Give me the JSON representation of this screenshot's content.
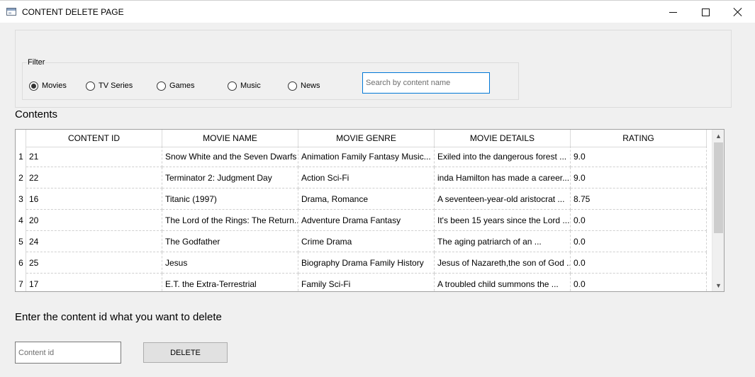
{
  "window": {
    "title": "CONTENT DELETE PAGE"
  },
  "filter": {
    "label": "Filter",
    "options": [
      {
        "label": "Movies",
        "checked": true
      },
      {
        "label": "TV Series",
        "checked": false
      },
      {
        "label": "Games",
        "checked": false
      },
      {
        "label": "Music",
        "checked": false
      },
      {
        "label": "News",
        "checked": false
      }
    ],
    "search_placeholder": "Search by content name"
  },
  "contents": {
    "label": "Contents",
    "columns": [
      "CONTENT ID",
      "MOVIE NAME",
      "MOVIE GENRE",
      "MOVIE DETAILS",
      "RATING"
    ],
    "rows": [
      {
        "num": "1",
        "id": "21",
        "name": "Snow White and the Seven Dwarfs",
        "genre": "Animation Family Fantasy Music...",
        "details": "Exiled into the dangerous forest ...",
        "rating": "9.0"
      },
      {
        "num": "2",
        "id": "22",
        "name": "Terminator 2: Judgment Day",
        "genre": "Action Sci-Fi",
        "details": "inda Hamilton has made a career...",
        "rating": "9.0"
      },
      {
        "num": "3",
        "id": "16",
        "name": "Titanic (1997)",
        "genre": "Drama, Romance",
        "details": "A seventeen-year-old aristocrat ...",
        "rating": "8.75"
      },
      {
        "num": "4",
        "id": "20",
        "name": "The Lord of the Rings: The Return...",
        "genre": "Adventure Drama Fantasy",
        "details": "It's been 15 years since the Lord ...",
        "rating": "0.0"
      },
      {
        "num": "5",
        "id": "24",
        "name": "The Godfather",
        "genre": "Crime Drama",
        "details": "The aging patriarch of an ...",
        "rating": "0.0"
      },
      {
        "num": "6",
        "id": "25",
        "name": "Jesus",
        "genre": "Biography Drama Family History",
        "details": "Jesus of Nazareth,the son of God ...",
        "rating": "0.0"
      },
      {
        "num": "7",
        "id": "17",
        "name": "E.T. the Extra-Terrestrial",
        "genre": " Family Sci-Fi",
        "details": "A troubled child summons the ...",
        "rating": "0.0"
      }
    ]
  },
  "delete_section": {
    "prompt": "Enter the content id what you want to delete",
    "input_placeholder": "Content id",
    "button_label": "DELETE"
  }
}
